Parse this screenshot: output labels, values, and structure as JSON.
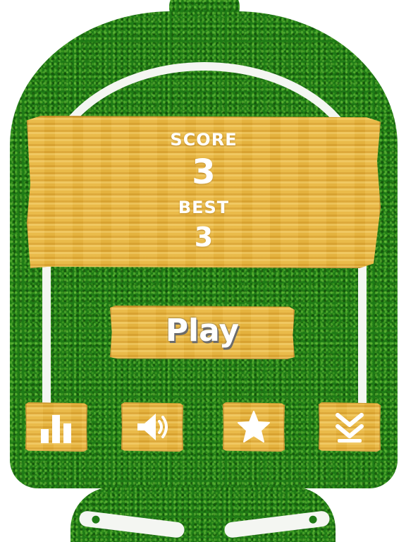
{
  "scoreboard": {
    "score_label": "SCORE",
    "score_value": "3",
    "best_label": "BEST",
    "best_value": "3"
  },
  "buttons": {
    "play_label": "Play"
  },
  "icons": [
    "leaderboard-icon",
    "sound-icon",
    "star-icon",
    "chevron-double-down-icon"
  ],
  "colors": {
    "grass": "#1f7a16",
    "wood": "#e7b43b",
    "rail": "#f4f6f2",
    "text": "#ffffff"
  }
}
